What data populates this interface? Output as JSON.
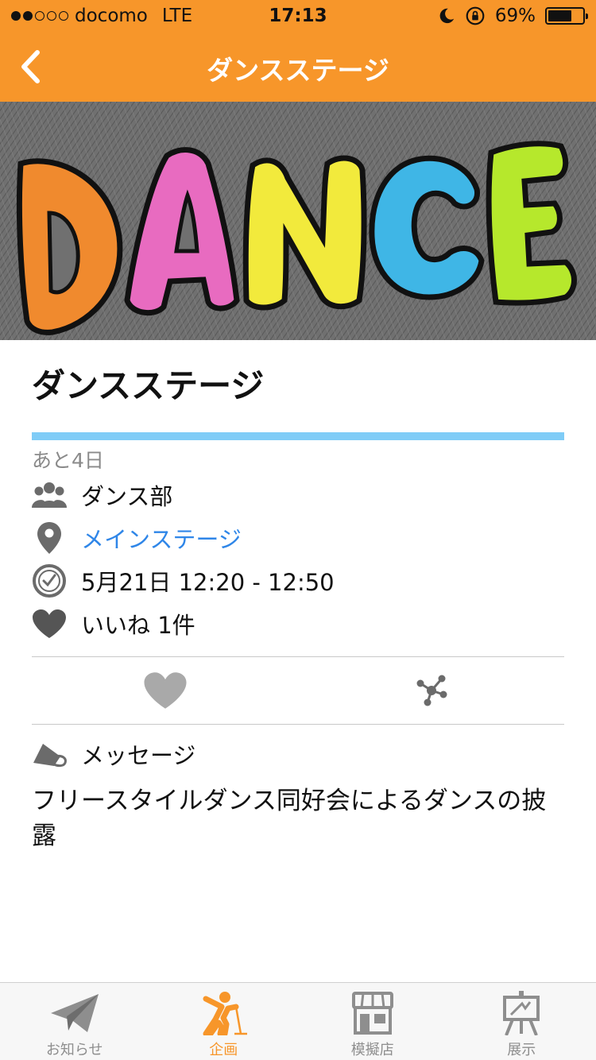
{
  "status_bar": {
    "carrier": "docomo",
    "network": "LTE",
    "time": "17:13",
    "battery": "69%",
    "battery_level": 0.69,
    "signal_bars": 2
  },
  "nav": {
    "title": "ダンスステージ",
    "back_icon": "chevron-left-icon"
  },
  "hero": {
    "letters": [
      "D",
      "A",
      "N",
      "C",
      "E"
    ],
    "letter_colors": [
      "#F08A2E",
      "#E86BC0",
      "#F2EA3C",
      "#3FB6E6",
      "#B6E82C"
    ]
  },
  "event": {
    "title": "ダンスステージ",
    "remaining": "あと4日",
    "organizer": "ダンス部",
    "location": "メインステージ",
    "datetime": "5月21日  12:20 - 12:50",
    "likes": "いいね 1件"
  },
  "message": {
    "heading": "メッセージ",
    "body": "フリースタイルダンス同好会によるダンスの披露"
  },
  "colors": {
    "accent": "#F7962A",
    "progress": "#7FCCF7",
    "link": "#2F86E8"
  },
  "tabs": [
    {
      "label": "お知らせ",
      "icon": "paper-plane-icon",
      "active": false
    },
    {
      "label": "企画",
      "icon": "singer-icon",
      "active": true
    },
    {
      "label": "模擬店",
      "icon": "shop-icon",
      "active": false
    },
    {
      "label": "展示",
      "icon": "easel-icon",
      "active": false
    }
  ]
}
